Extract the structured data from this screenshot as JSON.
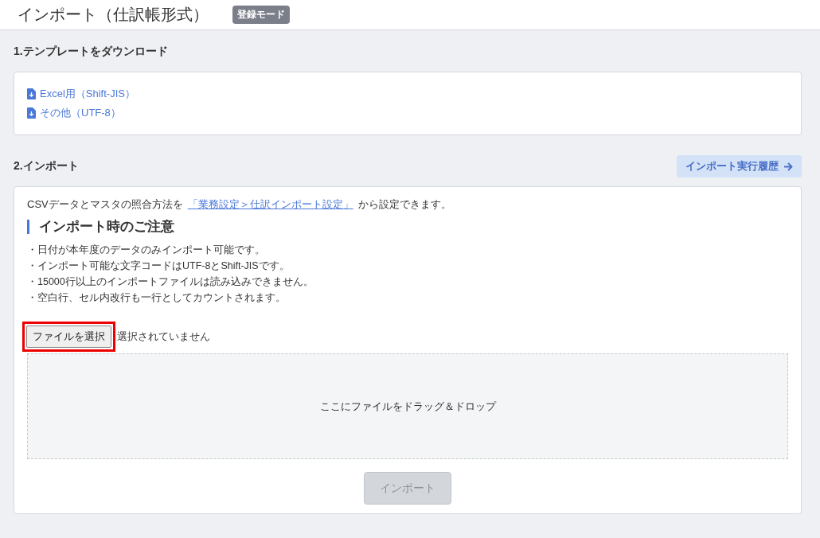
{
  "header": {
    "title": "インポート（仕訳帳形式）",
    "badge": "登録モード"
  },
  "template_section": {
    "title": "1.テンプレートをダウンロード",
    "links": [
      "Excel用（Shift-JIS）",
      "その他（UTF-8）"
    ]
  },
  "import_section": {
    "title": "2.インポート",
    "history_button": "インポート実行履歴",
    "intro": {
      "before": "CSVデータとマスタの照合方法を",
      "link": "「業務設定＞仕訳インポート設定」",
      "after": "から設定できます。"
    },
    "notice_title": "インポート時のご注意",
    "notes": [
      "・日付が本年度のデータのみインポート可能です。",
      "・インポート可能な文字コードはUTF-8とShift-JISです。",
      "・15000行以上のインポートファイルは読み込みできません。",
      "・空白行、セル内改行も一行としてカウントされます。"
    ],
    "file_button": {
      "label": "ファイルを選択",
      "highlighted": true
    },
    "file_status": "選択されていません",
    "drop_zone": "ここにファイルをドラッグ＆ドロップ",
    "import_button": {
      "label": "インポート",
      "disabled": true
    }
  }
}
